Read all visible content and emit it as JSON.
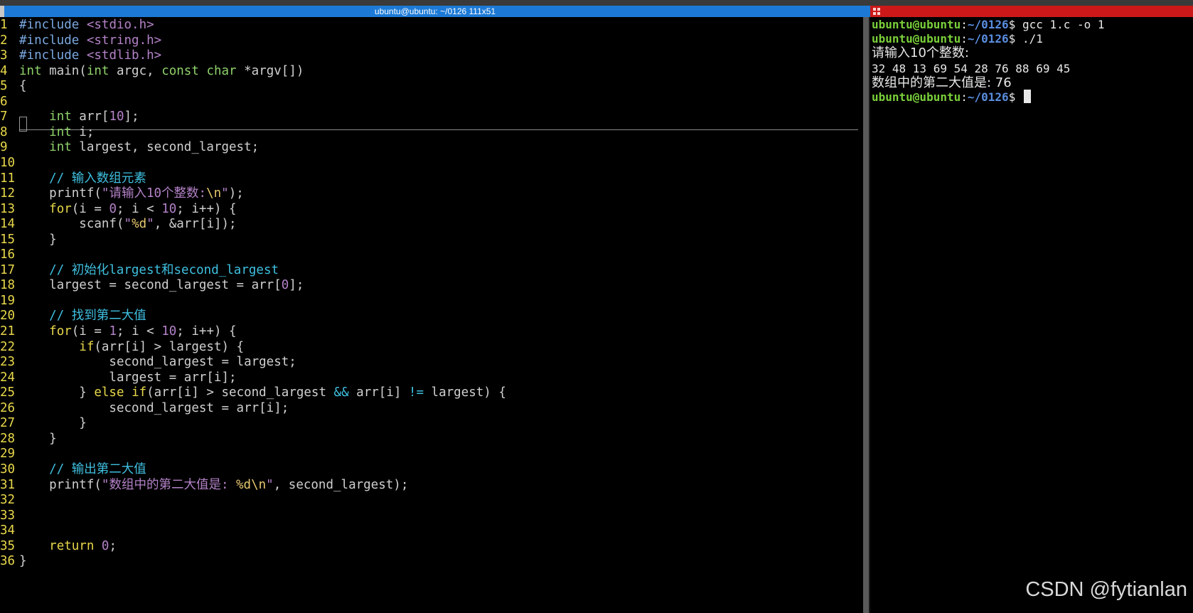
{
  "window": {
    "title": "ubuntu@ubuntu: ~/0126 111x51"
  },
  "editor": {
    "lines": [
      {
        "n": "1",
        "segs": [
          {
            "t": "#include",
            "c": "pre"
          },
          {
            "t": " "
          },
          {
            "t": "<stdio.h>",
            "c": "str"
          }
        ]
      },
      {
        "n": "2",
        "segs": [
          {
            "t": "#include",
            "c": "pre"
          },
          {
            "t": " "
          },
          {
            "t": "<string.h>",
            "c": "str"
          }
        ]
      },
      {
        "n": "3",
        "segs": [
          {
            "t": "#include",
            "c": "pre"
          },
          {
            "t": " "
          },
          {
            "t": "<stdlib.h>",
            "c": "str"
          }
        ]
      },
      {
        "n": "4",
        "segs": [
          {
            "t": "int",
            "c": "kw"
          },
          {
            "t": " main("
          },
          {
            "t": "int",
            "c": "kw"
          },
          {
            "t": " argc, "
          },
          {
            "t": "const",
            "c": "kw"
          },
          {
            "t": " "
          },
          {
            "t": "char",
            "c": "kw"
          },
          {
            "t": " *argv[])"
          }
        ]
      },
      {
        "n": "5",
        "segs": [
          {
            "t": "{"
          }
        ]
      },
      {
        "n": "6",
        "segs": [
          {
            "t": ""
          }
        ]
      },
      {
        "n": "7",
        "segs": [
          {
            "t": "    "
          },
          {
            "t": "int",
            "c": "kw"
          },
          {
            "t": " arr["
          },
          {
            "t": "10",
            "c": "num"
          },
          {
            "t": "];"
          }
        ]
      },
      {
        "n": "8",
        "segs": [
          {
            "t": "    "
          },
          {
            "t": "int",
            "c": "kw"
          },
          {
            "t": " i;"
          }
        ]
      },
      {
        "n": "9",
        "segs": [
          {
            "t": "    "
          },
          {
            "t": "int",
            "c": "kw"
          },
          {
            "t": " largest, second_largest;"
          }
        ]
      },
      {
        "n": "10",
        "segs": [
          {
            "t": ""
          }
        ]
      },
      {
        "n": "11",
        "segs": [
          {
            "t": "    "
          },
          {
            "t": "// 输入数组元素",
            "c": "cmt"
          }
        ]
      },
      {
        "n": "12",
        "segs": [
          {
            "t": "    printf("
          },
          {
            "t": "\"请输入10个整数:",
            "c": "str"
          },
          {
            "t": "\\n",
            "c": "esc"
          },
          {
            "t": "\"",
            "c": "str"
          },
          {
            "t": ");"
          }
        ]
      },
      {
        "n": "13",
        "segs": [
          {
            "t": "    "
          },
          {
            "t": "for",
            "c": "ctrl"
          },
          {
            "t": "(i = "
          },
          {
            "t": "0",
            "c": "num"
          },
          {
            "t": "; i < "
          },
          {
            "t": "10",
            "c": "num"
          },
          {
            "t": "; i++) {"
          }
        ]
      },
      {
        "n": "14",
        "segs": [
          {
            "t": "        scanf("
          },
          {
            "t": "\"",
            "c": "str"
          },
          {
            "t": "%d",
            "c": "esc"
          },
          {
            "t": "\"",
            "c": "str"
          },
          {
            "t": ", &arr[i]);"
          }
        ]
      },
      {
        "n": "15",
        "segs": [
          {
            "t": "    }"
          }
        ]
      },
      {
        "n": "16",
        "segs": [
          {
            "t": ""
          }
        ]
      },
      {
        "n": "17",
        "segs": [
          {
            "t": "    "
          },
          {
            "t": "// 初始化largest和second_largest",
            "c": "cmt"
          }
        ]
      },
      {
        "n": "18",
        "segs": [
          {
            "t": "    largest = second_largest = arr["
          },
          {
            "t": "0",
            "c": "num"
          },
          {
            "t": "];"
          }
        ]
      },
      {
        "n": "19",
        "segs": [
          {
            "t": ""
          }
        ]
      },
      {
        "n": "20",
        "segs": [
          {
            "t": "    "
          },
          {
            "t": "// 找到第二大值",
            "c": "cmt"
          }
        ]
      },
      {
        "n": "21",
        "segs": [
          {
            "t": "    "
          },
          {
            "t": "for",
            "c": "ctrl"
          },
          {
            "t": "(i = "
          },
          {
            "t": "1",
            "c": "num"
          },
          {
            "t": "; i < "
          },
          {
            "t": "10",
            "c": "num"
          },
          {
            "t": "; i++) {"
          }
        ]
      },
      {
        "n": "22",
        "segs": [
          {
            "t": "        "
          },
          {
            "t": "if",
            "c": "ctrl"
          },
          {
            "t": "(arr[i] > largest) {"
          }
        ]
      },
      {
        "n": "23",
        "segs": [
          {
            "t": "            second_largest = largest;"
          }
        ]
      },
      {
        "n": "24",
        "segs": [
          {
            "t": "            largest = arr[i];"
          }
        ]
      },
      {
        "n": "25",
        "segs": [
          {
            "t": "        } "
          },
          {
            "t": "else",
            "c": "ctrl"
          },
          {
            "t": " "
          },
          {
            "t": "if",
            "c": "ctrl"
          },
          {
            "t": "(arr[i] > second_largest "
          },
          {
            "t": "&&",
            "c": "cmt"
          },
          {
            "t": " arr[i] "
          },
          {
            "t": "!=",
            "c": "cmt"
          },
          {
            "t": " largest) {"
          }
        ]
      },
      {
        "n": "26",
        "segs": [
          {
            "t": "            second_largest = arr[i];"
          }
        ]
      },
      {
        "n": "27",
        "segs": [
          {
            "t": "        }"
          }
        ]
      },
      {
        "n": "28",
        "segs": [
          {
            "t": "    }"
          }
        ]
      },
      {
        "n": "29",
        "segs": [
          {
            "t": ""
          }
        ]
      },
      {
        "n": "30",
        "segs": [
          {
            "t": "    "
          },
          {
            "t": "// 输出第二大值",
            "c": "cmt"
          }
        ]
      },
      {
        "n": "31",
        "segs": [
          {
            "t": "    printf("
          },
          {
            "t": "\"数组中的第二大值是: ",
            "c": "str"
          },
          {
            "t": "%d\\n",
            "c": "esc"
          },
          {
            "t": "\"",
            "c": "str"
          },
          {
            "t": ", second_largest);"
          }
        ]
      },
      {
        "n": "32",
        "segs": [
          {
            "t": ""
          }
        ]
      },
      {
        "n": "33",
        "segs": [
          {
            "t": ""
          }
        ]
      },
      {
        "n": "34",
        "segs": [
          {
            "t": ""
          }
        ]
      },
      {
        "n": "35",
        "segs": [
          {
            "t": "    "
          },
          {
            "t": "return",
            "c": "ctrl"
          },
          {
            "t": " "
          },
          {
            "t": "0",
            "c": "num"
          },
          {
            "t": ";"
          }
        ]
      },
      {
        "n": "36",
        "segs": [
          {
            "t": "}"
          }
        ]
      }
    ]
  },
  "terminal": {
    "prompt_user": "ubuntu@ubuntu",
    "prompt_colon": ":",
    "prompt_path": "~/0126",
    "prompt_dollar": "$ ",
    "cmd1": "gcc 1.c -o 1",
    "cmd2": "./1",
    "out1": "请输入10个整数:",
    "out2": "32 48 13 69 54 28 76 88 69 45",
    "out3": "数组中的第二大值是: 76"
  },
  "watermark": "CSDN @fytianlan",
  "colors": {
    "title_left": "#1c7ad6",
    "title_right": "#cc1818",
    "line_number": "#e8d84a",
    "keyword": "#8fd26b",
    "string": "#b482c8",
    "comment": "#3fc0e0",
    "prompt_user": "#7ad03a",
    "prompt_path": "#5a8ee0"
  }
}
